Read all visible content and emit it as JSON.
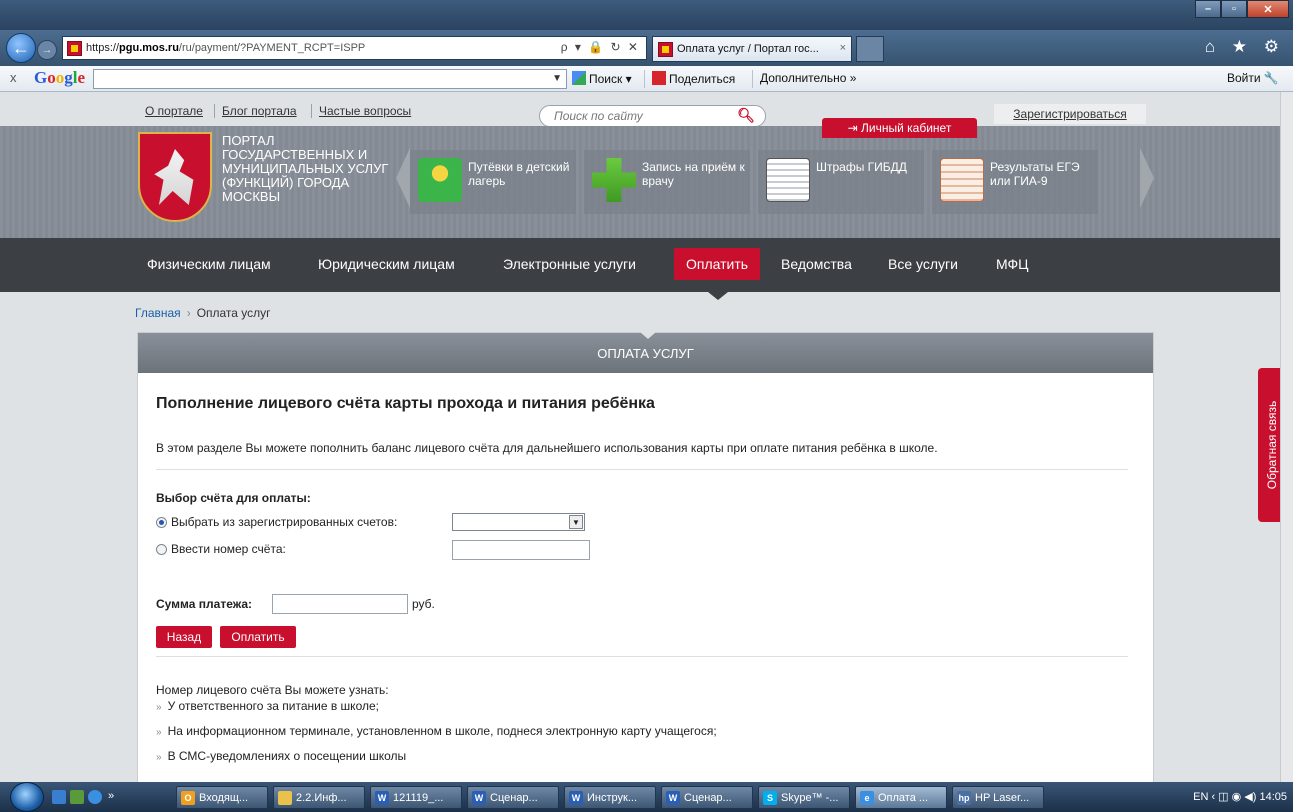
{
  "browser": {
    "url_prefix": "https://",
    "url_host": "pgu.mos.ru",
    "url_path": "/ru/payment/?PAYMENT_RCPT=ISPP",
    "addr_tools": "ρ ▾ 🔒 ↻ ✕",
    "tab_title": "Оплата услуг / Портал гос...",
    "tab_close": "×",
    "nav_icons": "⌂ ★ ⚙"
  },
  "google_toolbar": {
    "close": "x",
    "logo": [
      "G",
      "o",
      "o",
      "g",
      "l",
      "e"
    ],
    "search_button": "Поиск ▾",
    "share_button": "Поделиться",
    "more_button": "Дополнительно »",
    "signin_button": "Войти 🔧"
  },
  "site": {
    "top_links": [
      "О портале",
      "Блог портала",
      "Частые вопросы"
    ],
    "search_placeholder": "Поиск по сайту",
    "cabinet_label": "⇥ Личный кабинет",
    "register_label": "Зарегистрироваться",
    "portal_title": "ПОРТАЛ ГОСУДАРСТВЕННЫХ И МУНИЦИПАЛЬНЫХ УСЛУГ (ФУНКЦИЙ) ГОРОДА МОСКВЫ",
    "carousel": [
      {
        "label": "Путёвки в детский лагерь",
        "icon": "camp-icon",
        "color": "#3bb54a"
      },
      {
        "label": "Запись на приём к врачу",
        "icon": "medical-cross-icon",
        "color": "#66c23a"
      },
      {
        "label": "Штрафы ГИБДД",
        "icon": "fine-document-icon",
        "color": "#d8dde3"
      },
      {
        "label": "Результаты ЕГЭ или ГИА-9",
        "icon": "exam-form-icon",
        "color": "#f2e1d4"
      }
    ],
    "nav": [
      "Физическим лицам",
      "Юридическим лицам",
      "Электронные услуги",
      "Оплатить",
      "Ведомства",
      "Все услуги",
      "МФЦ"
    ],
    "nav_active_index": 3,
    "breadcrumb": {
      "home": "Главная",
      "separator": "›",
      "current": "Оплата услуг"
    },
    "feedback_tab": "Обратная связь",
    "accent_color": "#c8102e"
  },
  "panel": {
    "header": "ОПЛАТА УСЛУГ",
    "title": "Пополнение лицевого счёта карты прохода и питания ребёнка",
    "description": "В этом разделе Вы можете пополнить баланс лицевого счёта для дальнейшего использования карты при оплате питания ребёнка в школе.",
    "account_choice_label": "Выбор счёта для оплаты:",
    "radio_registered": "Выбрать из зарегистрированных счетов:",
    "radio_manual": "Ввести номер счёта:",
    "selected_radio": "registered",
    "select_value": "",
    "account_input_value": "",
    "sum_label": "Сумма платежа:",
    "sum_value": "",
    "currency": "руб.",
    "back_button": "Назад",
    "pay_button": "Оплатить",
    "info_heading": "Номер лицевого счёта Вы можете узнать:",
    "info_items": [
      "У ответственного за питание в школе;",
      "На информационном терминале, установленном в школе, поднеся электронную карту учащегося;",
      "В СМС-уведомлениях о посещении школы"
    ],
    "bullet_mark": "»"
  },
  "taskbar": {
    "tasks": [
      {
        "label": "Входящ...",
        "icon": "outlook-icon",
        "color": "#f0a020",
        "glyph": "O"
      },
      {
        "label": "2.2.Инф...",
        "icon": "folder-icon",
        "color": "#e8c24a",
        "glyph": ""
      },
      {
        "label": "121119_...",
        "icon": "word-icon",
        "color": "#2b5fb4",
        "glyph": "W"
      },
      {
        "label": "Сценар...",
        "icon": "word-icon",
        "color": "#2b5fb4",
        "glyph": "W"
      },
      {
        "label": "Инструк...",
        "icon": "word-icon",
        "color": "#2b5fb4",
        "glyph": "W"
      },
      {
        "label": "Сценар...",
        "icon": "word-icon",
        "color": "#2b5fb4",
        "glyph": "W"
      },
      {
        "label": "Skype™ -...",
        "icon": "skype-icon",
        "color": "#00aff0",
        "glyph": "S"
      },
      {
        "label": "Оплата ...",
        "icon": "ie-icon",
        "color": "#3b8fe0",
        "glyph": "e"
      },
      {
        "label": "HP Laser...",
        "icon": "printer-icon",
        "color": "#4a6fa5",
        "glyph": "hp"
      }
    ],
    "active_index": 7,
    "tray_text": "EN  ‹   ◫ ◉ ◀)  14:05",
    "clock": "14:05"
  }
}
